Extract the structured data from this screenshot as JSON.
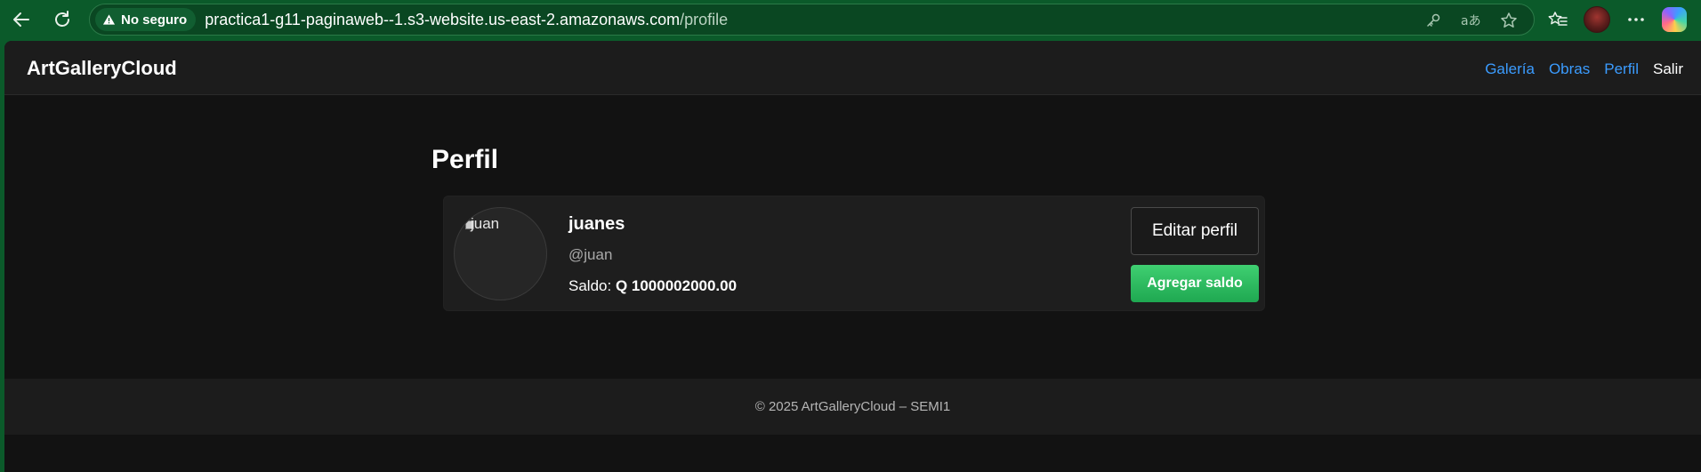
{
  "browser": {
    "security_label": "No seguro",
    "url_host": "practica1-g11-paginaweb--1.s3-website.us-east-2.amazonaws.com",
    "url_path": "/profile",
    "accent_color": "#0b5a2a"
  },
  "site": {
    "brand": "ArtGalleryCloud",
    "nav": {
      "gallery": "Galería",
      "works": "Obras",
      "profile": "Perfil",
      "logout": "Salir"
    },
    "link_color": "#3b9cff"
  },
  "profile": {
    "page_title": "Perfil",
    "avatar_alt": "juan",
    "display_name": "juanes",
    "username": "@juan",
    "balance_label": "Saldo:",
    "balance_value": "Q 1000002000.00",
    "edit_button": "Editar perfil",
    "add_balance_button": "Agregar saldo",
    "add_button_color": "#22b55a"
  },
  "footer": {
    "text": "© 2025 ArtGalleryCloud – SEMI1"
  }
}
